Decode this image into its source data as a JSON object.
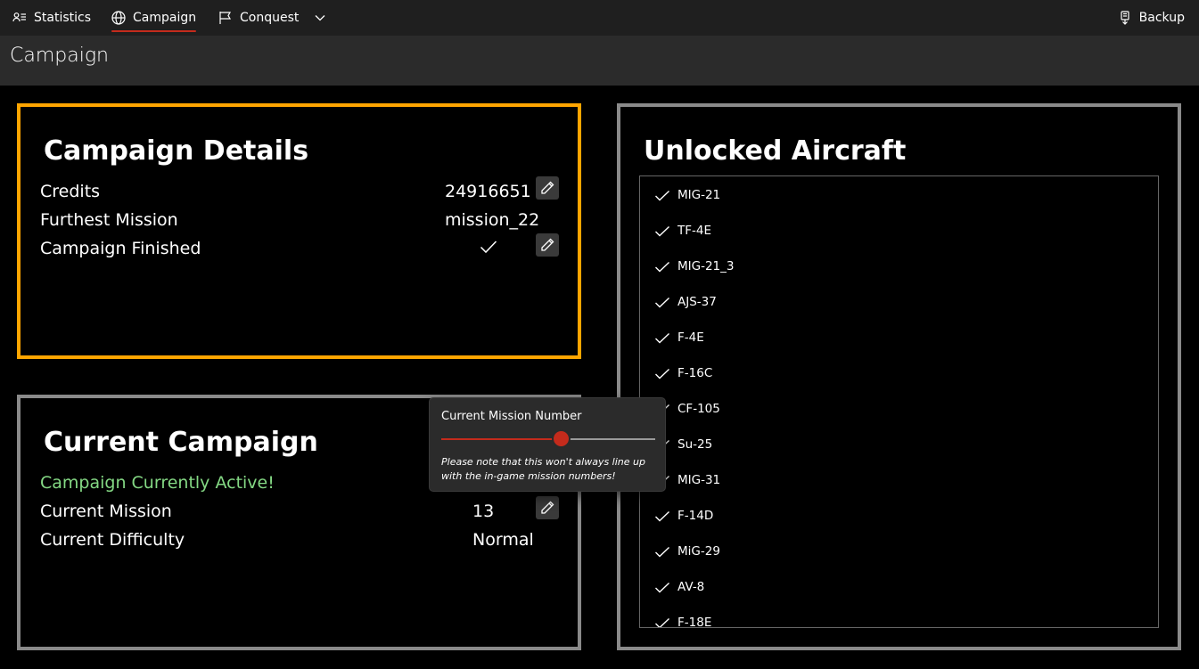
{
  "nav": {
    "statistics": "Statistics",
    "campaign": "Campaign",
    "conquest": "Conquest",
    "backup": "Backup"
  },
  "page": {
    "title": "Campaign"
  },
  "details": {
    "title": "Campaign Details",
    "credits_label": "Credits",
    "credits_value": "24916651",
    "furthest_label": "Furthest Mission",
    "furthest_value": "mission_22",
    "finished_label": "Campaign Finished",
    "finished_checked": true
  },
  "current": {
    "title": "Current Campaign",
    "status": "Campaign Currently Active!",
    "mission_label": "Current Mission",
    "mission_value": "13",
    "difficulty_label": "Current Difficulty",
    "difficulty_value": "Normal"
  },
  "popup": {
    "title": "Current Mission Number",
    "slider_fraction": 0.56,
    "note": "Please note that this won't always line up with the in-game mission numbers!"
  },
  "aircraft": {
    "title": "Unlocked Aircraft",
    "items": [
      "MIG-21",
      "TF-4E",
      "MIG-21_3",
      "AJS-37",
      "F-4E",
      "F-16C",
      "CF-105",
      "Su-25",
      "MIG-31",
      "F-14D",
      "MiG-29",
      "AV-8",
      "F-18E"
    ]
  },
  "colors": {
    "accent": "#c42b1c",
    "highlight_border": "#ffa500",
    "active_text": "#84d884"
  }
}
